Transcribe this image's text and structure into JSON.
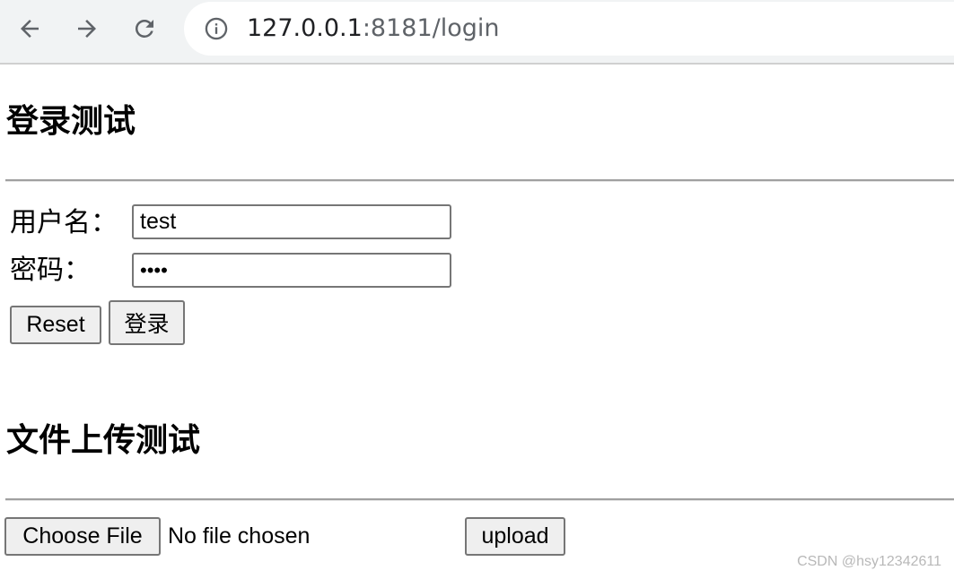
{
  "browser": {
    "url_host": "127.0.0.1",
    "url_rest": ":8181/login"
  },
  "login_section": {
    "title": "登录测试",
    "username_label": "用户名：",
    "username_value": "test",
    "password_label": "密码：",
    "password_value": "••••",
    "reset_label": "Reset",
    "submit_label": "登录"
  },
  "upload_section": {
    "title": "文件上传测试",
    "choose_file_label": "Choose File",
    "file_status": "No file chosen",
    "upload_label": "upload"
  },
  "watermark": "CSDN @hsy12342611"
}
